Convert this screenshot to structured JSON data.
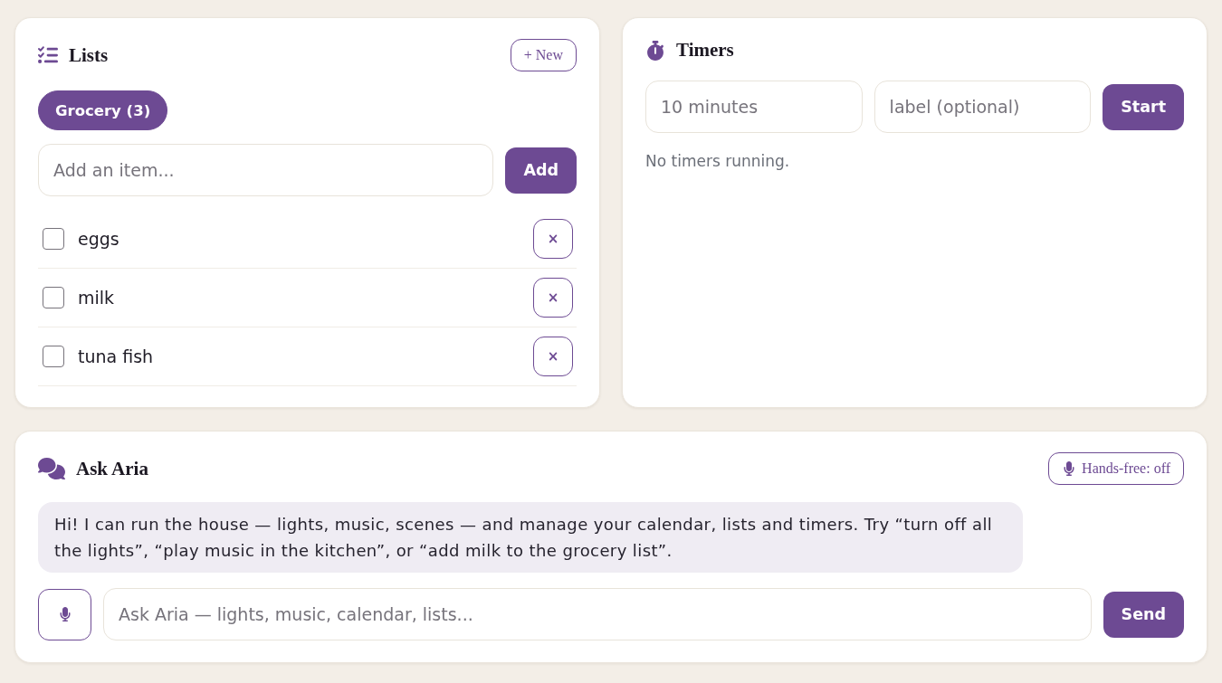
{
  "lists": {
    "title": "Lists",
    "new_button": "+ New",
    "tabs": [
      {
        "label": "Grocery (3)",
        "selected": true
      }
    ],
    "add_input": {
      "placeholder": "Add an item..."
    },
    "add_button": "Add",
    "items": [
      {
        "text": "eggs",
        "checked": false,
        "remove": "×"
      },
      {
        "text": "milk",
        "checked": false,
        "remove": "×"
      },
      {
        "text": "tuna fish",
        "checked": false,
        "remove": "×"
      }
    ]
  },
  "timers": {
    "title": "Timers",
    "duration_input": {
      "placeholder": "10 minutes"
    },
    "label_input": {
      "placeholder": "label (optional)"
    },
    "start_button": "Start",
    "status": "No timers running."
  },
  "assistant": {
    "title": "Ask Aria",
    "hands_free_button": "Hands-free: off",
    "messages": [
      {
        "kind": "assistant",
        "text": "Hi! I can run the house — lights, music, scenes — and manage your calendar, lists and timers. Try “turn off all the lights”, “play music in the kitchen”, or “add milk to the grocery list”."
      }
    ],
    "input": {
      "placeholder": "Ask Aria — lights, music, calendar, lists..."
    },
    "send_button": "Send"
  }
}
